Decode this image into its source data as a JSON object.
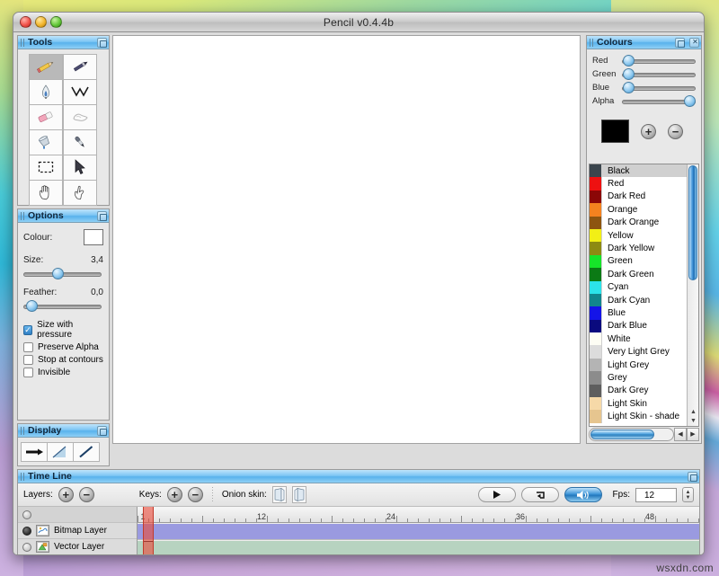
{
  "window": {
    "title": "Pencil v0.4.4b"
  },
  "tools": {
    "title": "Tools",
    "items": [
      {
        "name": "pencil",
        "icon": "pencil-icon",
        "selected": true
      },
      {
        "name": "brush",
        "icon": "brush-icon",
        "selected": false
      },
      {
        "name": "pen",
        "icon": "pen-icon",
        "selected": false
      },
      {
        "name": "polyline",
        "icon": "polyline-icon",
        "selected": false
      },
      {
        "name": "eraser",
        "icon": "eraser-icon",
        "selected": false
      },
      {
        "name": "smudge",
        "icon": "smudge-icon",
        "selected": false
      },
      {
        "name": "bucket",
        "icon": "paint-bucket-icon",
        "selected": false
      },
      {
        "name": "eyedropper",
        "icon": "eyedropper-icon",
        "selected": false
      },
      {
        "name": "select",
        "icon": "marquee-select-icon",
        "selected": false
      },
      {
        "name": "move",
        "icon": "arrow-cursor-icon",
        "selected": false
      },
      {
        "name": "hand",
        "icon": "hand-icon",
        "selected": false
      },
      {
        "name": "finger",
        "icon": "finger-smudge-icon",
        "selected": false
      }
    ]
  },
  "options": {
    "title": "Options",
    "colour_label": "Colour:",
    "colour_value": "#000000",
    "size_label": "Size:",
    "size_value": "3,4",
    "size_percent": 36,
    "feather_label": "Feather:",
    "feather_value": "0,0",
    "feather_percent": 3,
    "checkboxes": [
      {
        "label": "Size with pressure",
        "checked": true
      },
      {
        "label": "Preserve Alpha",
        "checked": false
      },
      {
        "label": "Stop at contours",
        "checked": false
      },
      {
        "label": "Invisible",
        "checked": false
      }
    ]
  },
  "display": {
    "title": "Display",
    "buttons": [
      {
        "name": "thick-line-icon"
      },
      {
        "name": "antialias-icon"
      },
      {
        "name": "stroke-icon"
      }
    ]
  },
  "colours": {
    "title": "Colours",
    "sliders": [
      {
        "label": "Red",
        "percent": 2
      },
      {
        "label": "Green",
        "percent": 2
      },
      {
        "label": "Blue",
        "percent": 2
      },
      {
        "label": "Alpha",
        "percent": 100
      }
    ],
    "current_colour": "#000000",
    "add_label": "+",
    "remove_label": "−",
    "list": [
      {
        "name": "Black",
        "hex": "#3b454d",
        "selected": true
      },
      {
        "name": "Red",
        "hex": "#ee1111",
        "selected": false
      },
      {
        "name": "Dark Red",
        "hex": "#8b0707",
        "selected": false
      },
      {
        "name": "Orange",
        "hex": "#f4821f",
        "selected": false
      },
      {
        "name": "Dark Orange",
        "hex": "#8d5510",
        "selected": false
      },
      {
        "name": "Yellow",
        "hex": "#f2ef16",
        "selected": false
      },
      {
        "name": "Dark Yellow",
        "hex": "#8d8a12",
        "selected": false
      },
      {
        "name": "Green",
        "hex": "#16e429",
        "selected": false
      },
      {
        "name": "Dark Green",
        "hex": "#0b7a15",
        "selected": false
      },
      {
        "name": "Cyan",
        "hex": "#2ce3ea",
        "selected": false
      },
      {
        "name": "Dark Cyan",
        "hex": "#11868d",
        "selected": false
      },
      {
        "name": "Blue",
        "hex": "#1414e8",
        "selected": false
      },
      {
        "name": "Dark Blue",
        "hex": "#0a0a7e",
        "selected": false
      },
      {
        "name": "White",
        "hex": "#fdfdf4",
        "selected": false
      },
      {
        "name": "Very Light Grey",
        "hex": "#dcdcdc",
        "selected": false
      },
      {
        "name": "Light Grey",
        "hex": "#b4b4b4",
        "selected": false
      },
      {
        "name": "Grey",
        "hex": "#8c8c8c",
        "selected": false
      },
      {
        "name": "Dark Grey",
        "hex": "#5e5e5e",
        "selected": false
      },
      {
        "name": "Light Skin",
        "hex": "#f6d9a8",
        "selected": false
      },
      {
        "name": "Light Skin - shade",
        "hex": "#e6c58f",
        "selected": false
      }
    ]
  },
  "timeline": {
    "title": "Time Line",
    "layers_label": "Layers:",
    "keys_label": "Keys:",
    "onion_label": "Onion skin:",
    "add_label": "+",
    "remove_label": "−",
    "play_icon": "play-icon",
    "loop_icon": "loop-icon",
    "sound_icon": "sound-icon",
    "fps_label": "Fps:",
    "fps_value": "12",
    "ruler_marks": [
      "1",
      "12",
      "24",
      "36",
      "48"
    ],
    "current_frame": 1,
    "layers": [
      {
        "name": "Bitmap Layer",
        "visible": true,
        "icon": "bitmap-layer-icon",
        "track_color": "#9a9ae0"
      },
      {
        "name": "Vector Layer",
        "visible": false,
        "icon": "vector-layer-icon",
        "track_color": "#b7d3c0"
      }
    ]
  },
  "watermark": {
    "text": "wsxdn.com"
  }
}
